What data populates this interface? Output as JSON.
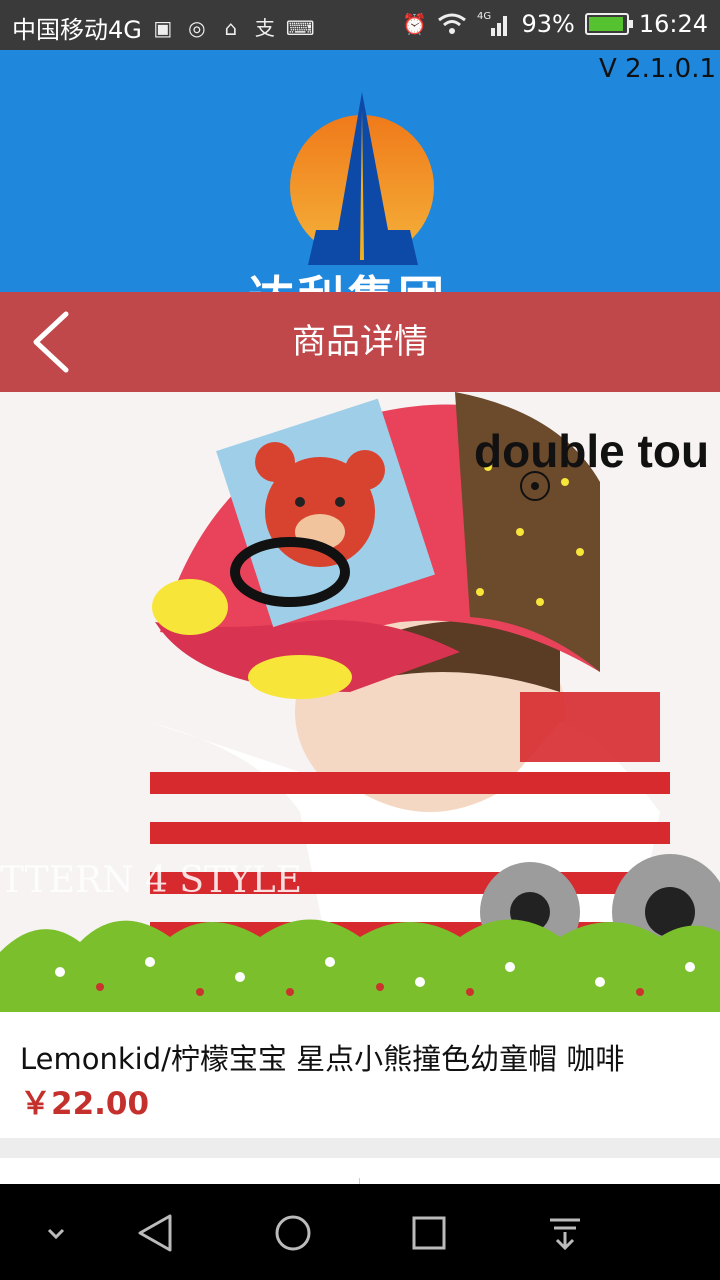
{
  "status_bar": {
    "carrier": "中国移动4G",
    "network": "4G",
    "battery": "93%",
    "time": "16:24"
  },
  "splash": {
    "version": "V 2.1.0.1",
    "logo_text": "达利集团"
  },
  "navbar": {
    "title": "商品详情"
  },
  "overlay": {
    "gesture_hint": "double tou"
  },
  "product": {
    "image_caption": "TTERN 4 STYLE",
    "name": "Lemonkid/柠檬宝宝 星点小熊撞色幼童帽 咖啡",
    "price": "￥22.00"
  },
  "colors": {
    "navbar": "#c0484b",
    "splash": "#1f87dc",
    "price": "#c4302b"
  },
  "icons": [
    "back-arrow-icon",
    "logo-icon",
    "nav-down-icon",
    "nav-back-icon",
    "nav-home-icon",
    "nav-recents-icon",
    "nav-notification-icon"
  ]
}
